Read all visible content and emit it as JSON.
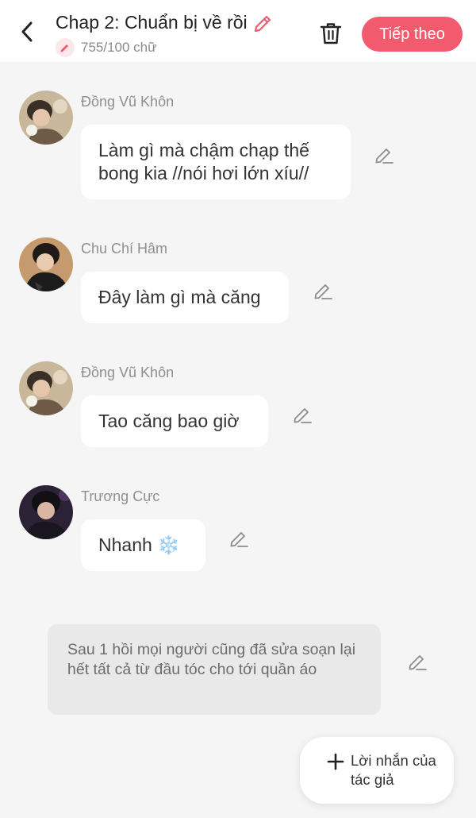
{
  "header": {
    "title": "Chap 2: Chuẩn bị về rồi",
    "word_count": "755/100 chữ",
    "next_label": "Tiếp theo"
  },
  "messages": [
    {
      "sender": "Đồng Vũ Khôn",
      "text": "Làm gì mà chậm chạp thế bong kia //nói hơi lớn xíu//"
    },
    {
      "sender": "Chu Chí Hâm",
      "text": "Đây làm gì mà căng"
    },
    {
      "sender": "Đồng Vũ Khôn",
      "text": "Tao căng bao giờ"
    },
    {
      "sender": "Trương Cực",
      "text": "Nhanh ❄️"
    }
  ],
  "narration": {
    "text": "Sau 1 hồi mọi người cũng đã sửa soạn lại hết tất cả từ đầu tóc cho tới quần áo"
  },
  "author_note": {
    "label": "Lời nhắn của tác giả"
  },
  "colors": {
    "accent": "#f25a6e",
    "background": "#f5f5f5",
    "bubble": "#ffffff",
    "narration_bg": "#e9e9e9"
  },
  "icons": {
    "back": "chevron-left-icon",
    "title_edit": "pencil-icon",
    "delete": "trash-icon",
    "edit": "pencil-icon",
    "add": "plus-icon"
  }
}
